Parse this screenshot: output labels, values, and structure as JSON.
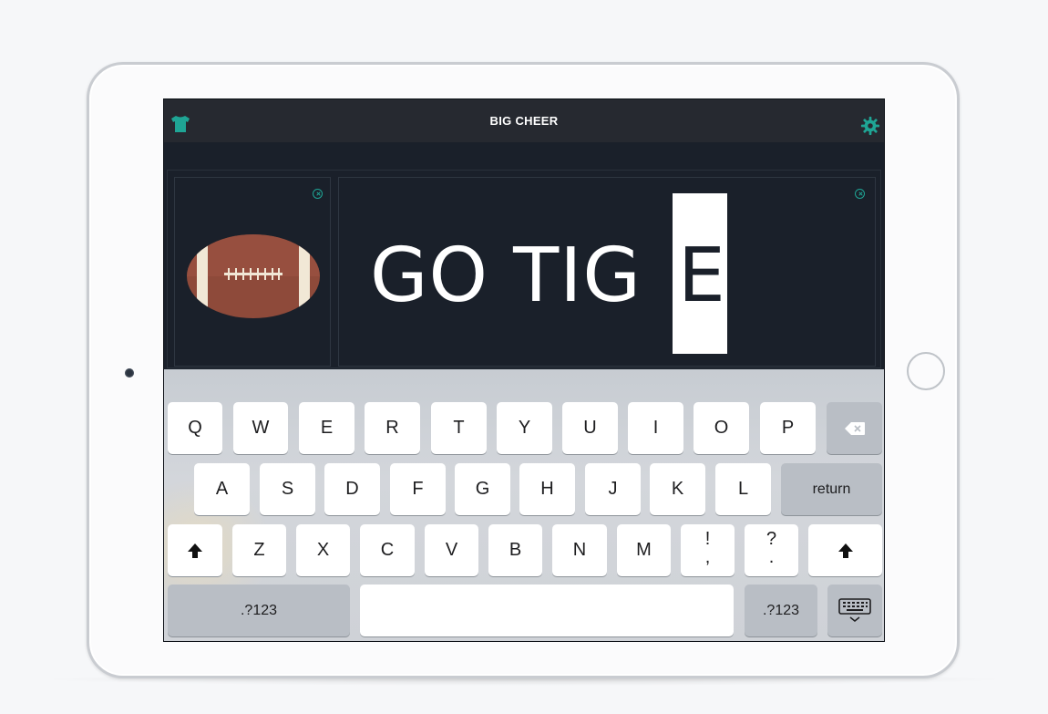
{
  "app": {
    "title": "BIG CHEER",
    "accent_color": "#1fa595",
    "icons": {
      "left": "shirt-icon",
      "right": "gear-icon"
    }
  },
  "canvas": {
    "image_card": {
      "content": "football-image",
      "close_icon": "close-icon"
    },
    "text_card": {
      "text": "GO TIG",
      "highlighted_char": "E",
      "close_icon": "close-icon"
    }
  },
  "keyboard": {
    "row1": [
      "Q",
      "W",
      "E",
      "R",
      "T",
      "Y",
      "U",
      "I",
      "O",
      "P"
    ],
    "row2": [
      "A",
      "S",
      "D",
      "F",
      "G",
      "H",
      "J",
      "K",
      "L"
    ],
    "row3": [
      "Z",
      "X",
      "C",
      "V",
      "B",
      "N",
      "M"
    ],
    "exclaim": {
      "top": "!",
      "bottom": ","
    },
    "question": {
      "top": "?",
      "bottom": "."
    },
    "return_label": "return",
    "numbers_label": ".?123",
    "icons": {
      "backspace": "backspace-icon",
      "shift": "shift-icon",
      "dismiss": "keyboard-dismiss-icon"
    }
  }
}
